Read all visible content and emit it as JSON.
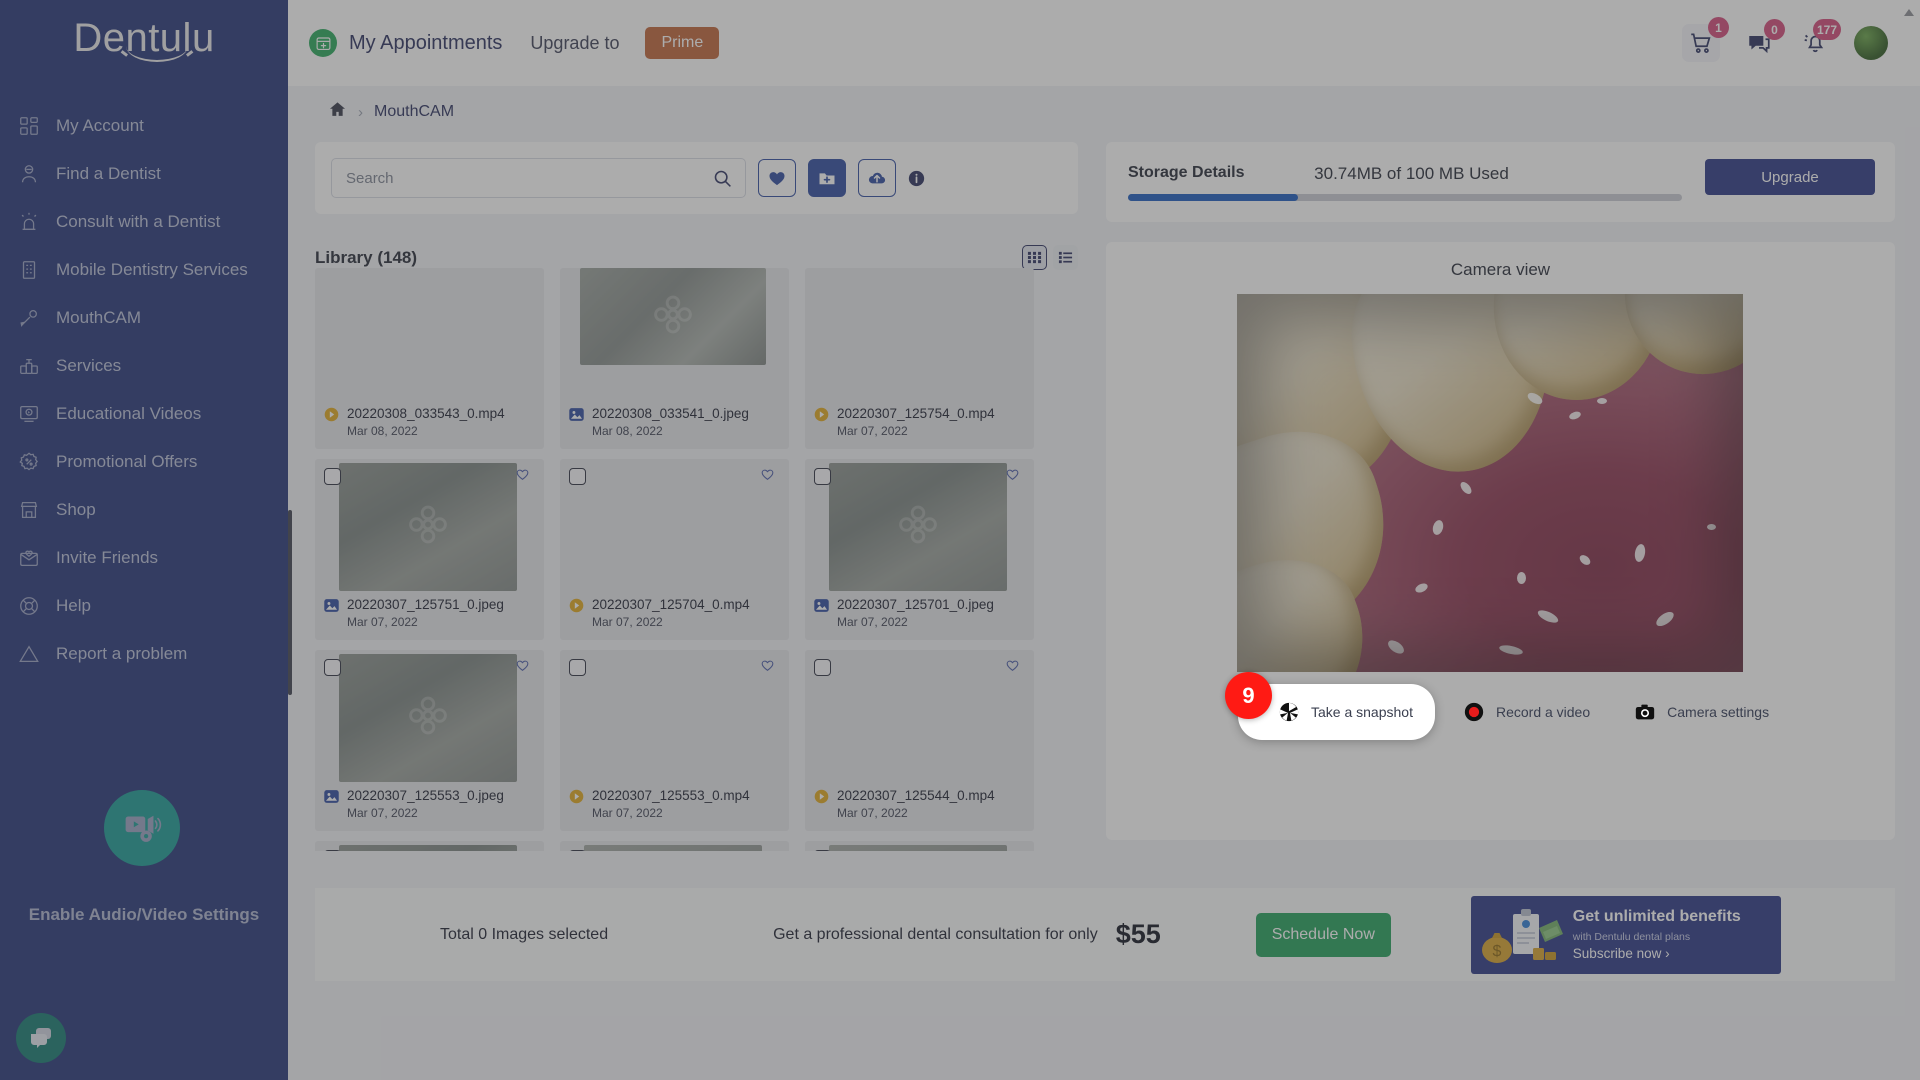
{
  "brand": {
    "name": "Dentulu"
  },
  "sidebar": {
    "items": [
      {
        "label": "My Account",
        "icon": "grid-icon"
      },
      {
        "label": "Find a Dentist",
        "icon": "person-search-icon"
      },
      {
        "label": "Consult with a Dentist",
        "icon": "consult-icon"
      },
      {
        "label": "Mobile Dentistry Services",
        "icon": "building-icon"
      },
      {
        "label": "MouthCAM",
        "icon": "mouthcam-icon"
      },
      {
        "label": "Services",
        "icon": "services-icon"
      },
      {
        "label": "Educational Videos",
        "icon": "video-lesson-icon"
      },
      {
        "label": "Promotional Offers",
        "icon": "percent-badge-icon"
      },
      {
        "label": "Shop",
        "icon": "store-icon"
      },
      {
        "label": "Invite Friends",
        "icon": "envelope-heart-icon"
      },
      {
        "label": "Help",
        "icon": "lifebuoy-icon"
      },
      {
        "label": "Report a problem",
        "icon": "warning-triangle-icon"
      }
    ],
    "enable_av_label": "Enable Audio/Video Settings",
    "av_fab_icon": "video-settings-icon",
    "chat_fab_icon": "chat-bubble-icon"
  },
  "topbar": {
    "appointments_label": "My Appointments",
    "appointments_icon": "calendar-plus-icon",
    "upgrade_label": "Upgrade to",
    "prime_label": "Prime",
    "cart": {
      "icon": "shopping-cart-icon",
      "badge": "1"
    },
    "messages": {
      "icon": "chat-icon",
      "badge": "0"
    },
    "notifications": {
      "icon": "bell-icon",
      "badge": "177"
    },
    "avatar": "user-avatar"
  },
  "breadcrumb": {
    "home_icon": "home-icon",
    "separator": "›",
    "current": "MouthCAM"
  },
  "search": {
    "placeholder": "Search",
    "value": "",
    "search_icon": "search-icon",
    "favorites_icon": "heart-filled-icon",
    "new_folder_icon": "folder-plus-icon",
    "upload_icon": "cloud-upload-icon",
    "info_icon": "info-icon"
  },
  "library": {
    "title": "Library (148)",
    "grid_view_icon": "grid-view-icon",
    "list_view_icon": "list-view-icon",
    "active_view": "grid",
    "files": [
      {
        "name": "20220308_033543_0.mp4",
        "date": "Mar 08, 2022",
        "type": "video",
        "thumb": "blank",
        "thumb_style": "square",
        "row": 0
      },
      {
        "name": "20220308_033541_0.jpeg",
        "date": "Mar 08, 2022",
        "type": "image",
        "thumb": "tex-b",
        "thumb_style": "wide",
        "row": 0
      },
      {
        "name": "20220307_125754_0.mp4",
        "date": "Mar 07, 2022",
        "type": "video",
        "thumb": "blank",
        "thumb_style": "square",
        "row": 0
      },
      {
        "name": "20220307_125751_0.jpeg",
        "date": "Mar 07, 2022",
        "type": "image",
        "thumb": "tex-a",
        "thumb_style": "square",
        "row": 1
      },
      {
        "name": "20220307_125704_0.mp4",
        "date": "Mar 07, 2022",
        "type": "video",
        "thumb": "blank",
        "thumb_style": "square",
        "row": 1
      },
      {
        "name": "20220307_125701_0.jpeg",
        "date": "Mar 07, 2022",
        "type": "image",
        "thumb": "tex-a",
        "thumb_style": "square",
        "row": 1
      },
      {
        "name": "20220307_125553_0.jpeg",
        "date": "Mar 07, 2022",
        "type": "image",
        "thumb": "tex-a",
        "thumb_style": "square",
        "row": 2
      },
      {
        "name": "20220307_125553_0.mp4",
        "date": "Mar 07, 2022",
        "type": "video",
        "thumb": "blank",
        "thumb_style": "square",
        "row": 2
      },
      {
        "name": "20220307_125544_0.mp4",
        "date": "Mar 07, 2022",
        "type": "video",
        "thumb": "blank",
        "thumb_style": "square",
        "row": 2
      },
      {
        "name": "",
        "date": "",
        "type": "image",
        "thumb": "tex-a",
        "thumb_style": "square",
        "row": 3
      },
      {
        "name": "",
        "date": "",
        "type": "image",
        "thumb": "tex-c",
        "thumb_style": "square",
        "row": 3
      },
      {
        "name": "",
        "date": "",
        "type": "image",
        "thumb": "tex-c",
        "thumb_style": "square",
        "row": 3
      }
    ]
  },
  "storage": {
    "label": "Storage Details",
    "used_text": "30.74MB of 100 MB Used",
    "percent": 30.74,
    "upgrade_label": "Upgrade"
  },
  "camera": {
    "view_label": "Camera view",
    "snapshot_label": "Take a snapshot",
    "snapshot_icon": "aperture-icon",
    "record_label": "Record a video",
    "record_icon": "record-circle-icon",
    "settings_label": "Camera settings",
    "settings_icon": "camera-icon",
    "step_badge": "9"
  },
  "bottom": {
    "selected_text": "Total 0 Images selected",
    "promo_text": "Get a professional dental consultation for only",
    "price": "$55",
    "schedule_label": "Schedule Now",
    "banner": {
      "title": "Get unlimited benefits",
      "subtitle": "with Dentulu dental plans",
      "cta": "Subscribe now ›",
      "icon": "money-clipboard-icon"
    }
  },
  "colors": {
    "sidebar_bg": "#253579",
    "accent_blue": "#2a3785",
    "prime_orange": "#c0643a",
    "green": "#23a05c",
    "badge_pink": "#d44a7a",
    "step_red": "#ff1a14",
    "teal": "#1b9c96",
    "storage_bar": "#1d5cc0"
  }
}
